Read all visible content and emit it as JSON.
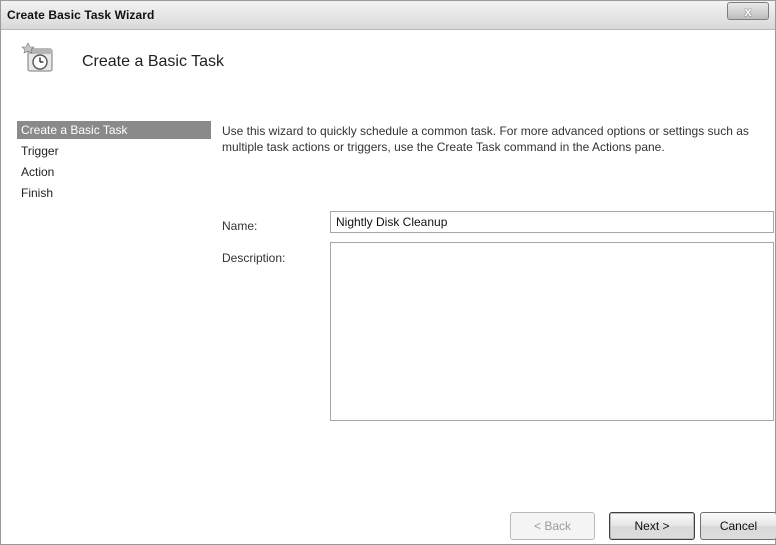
{
  "window": {
    "title": "Create Basic Task Wizard",
    "close_label": "x"
  },
  "header": {
    "title": "Create a Basic Task",
    "icon": "scheduled-task-clock-icon"
  },
  "nav": {
    "items": [
      {
        "label": "Create a Basic Task",
        "active": true
      },
      {
        "label": "Trigger",
        "active": false
      },
      {
        "label": "Action",
        "active": false
      },
      {
        "label": "Finish",
        "active": false
      }
    ]
  },
  "main": {
    "intro": "Use this wizard to quickly schedule a common task.  For more advanced options or settings such as multiple task actions or triggers, use the Create Task command in the Actions pane.",
    "name_label": "Name:",
    "name_value": "Nightly Disk Cleanup",
    "description_label": "Description:",
    "description_value": ""
  },
  "buttons": {
    "back": "< Back",
    "next": "Next >",
    "cancel": "Cancel"
  }
}
